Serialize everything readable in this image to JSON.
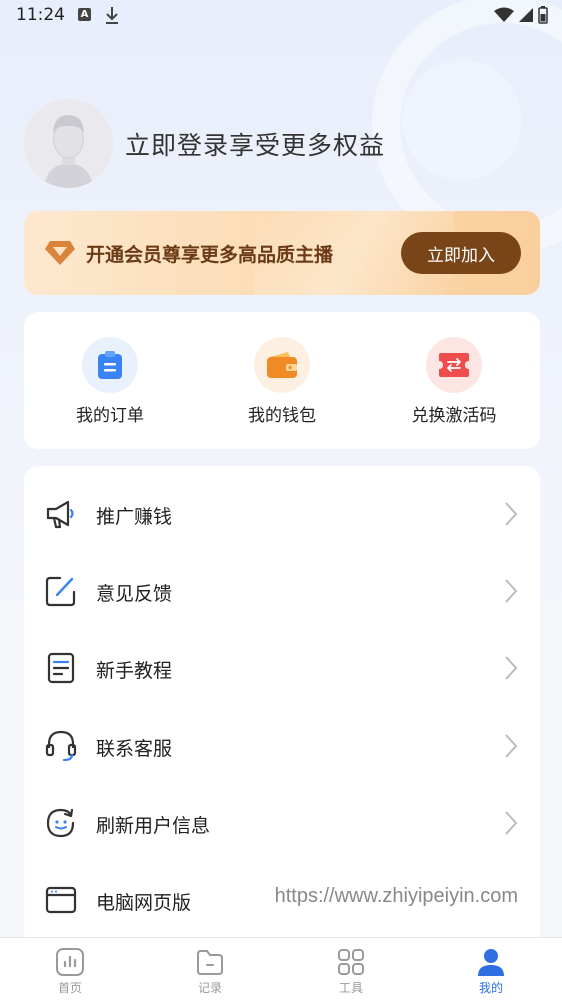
{
  "status_bar": {
    "time": "11:24",
    "notification_a": "A"
  },
  "profile": {
    "login_prompt": "立即登录享受更多权益"
  },
  "vip_banner": {
    "text": "开通会员尊享更多高品质主播",
    "button_label": "立即加入",
    "accent_color": "#7a4419"
  },
  "quick_actions": [
    {
      "label": "我的订单",
      "icon": "clipboard-icon"
    },
    {
      "label": "我的钱包",
      "icon": "wallet-icon"
    },
    {
      "label": "兑换激活码",
      "icon": "ticket-icon"
    }
  ],
  "menu": {
    "items": [
      {
        "label": "推广赚钱",
        "icon": "megaphone-icon"
      },
      {
        "label": "意见反馈",
        "icon": "edit-icon"
      },
      {
        "label": "新手教程",
        "icon": "document-icon"
      },
      {
        "label": "联系客服",
        "icon": "headset-icon"
      },
      {
        "label": "刷新用户信息",
        "icon": "refresh-icon"
      },
      {
        "label": "电脑网页版",
        "icon": "browser-icon",
        "value": "https://www.zhiyipeiyin.com"
      }
    ]
  },
  "bottom_nav": {
    "items": [
      {
        "label": "首页",
        "icon": "chart-icon",
        "active": false
      },
      {
        "label": "记录",
        "icon": "folder-icon",
        "active": false
      },
      {
        "label": "工具",
        "icon": "grid-icon",
        "active": false
      },
      {
        "label": "我的",
        "icon": "user-icon",
        "active": true
      }
    ],
    "active_color": "#2f6fe0"
  }
}
